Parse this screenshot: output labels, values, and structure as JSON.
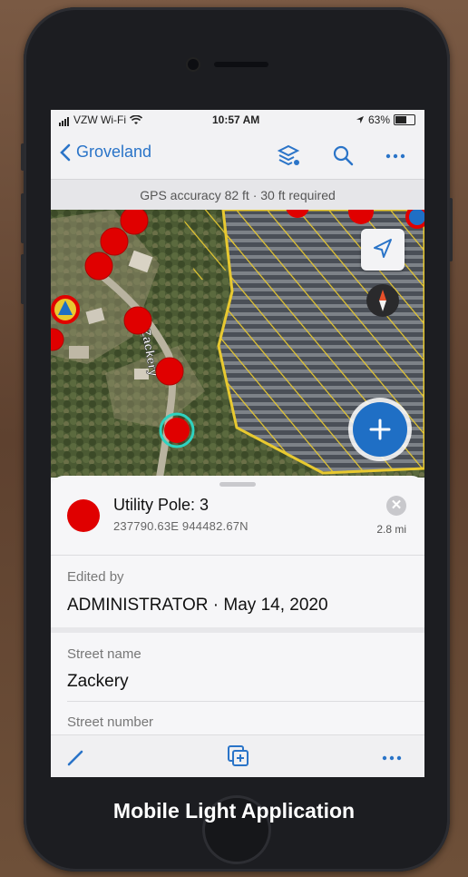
{
  "status_bar": {
    "carrier": "VZW Wi-Fi",
    "time": "10:57 AM",
    "battery": "63%",
    "battery_level": 0.63
  },
  "nav": {
    "back_label": "Groveland",
    "icons": [
      "layers-icon",
      "search-icon",
      "more-icon"
    ]
  },
  "gps_banner": {
    "text": "GPS accuracy 82 ft  ·  30 ft required"
  },
  "map": {
    "street_label": "Zackery",
    "controls": [
      "locate-icon",
      "compass-icon",
      "add-icon"
    ],
    "accent_color": "#1f6fc5",
    "pole_color": "#e00000",
    "hatch_color": "#e8c930"
  },
  "feature": {
    "title": "Utility Pole: 3",
    "coordinates": "237790.63E 944482.67N",
    "distance": "2.8 mi",
    "close_symbol": "✕"
  },
  "fields": [
    {
      "label": "Edited by",
      "value": "ADMINISTRATOR · May 14, 2020"
    },
    {
      "label": "Street name",
      "value": "Zackery"
    },
    {
      "label": "Street number",
      "value": ""
    }
  ],
  "toolbar": {
    "icons": [
      "edit-icon",
      "copy-add-icon",
      "more-icon"
    ]
  },
  "caption": "Mobile Light Application"
}
